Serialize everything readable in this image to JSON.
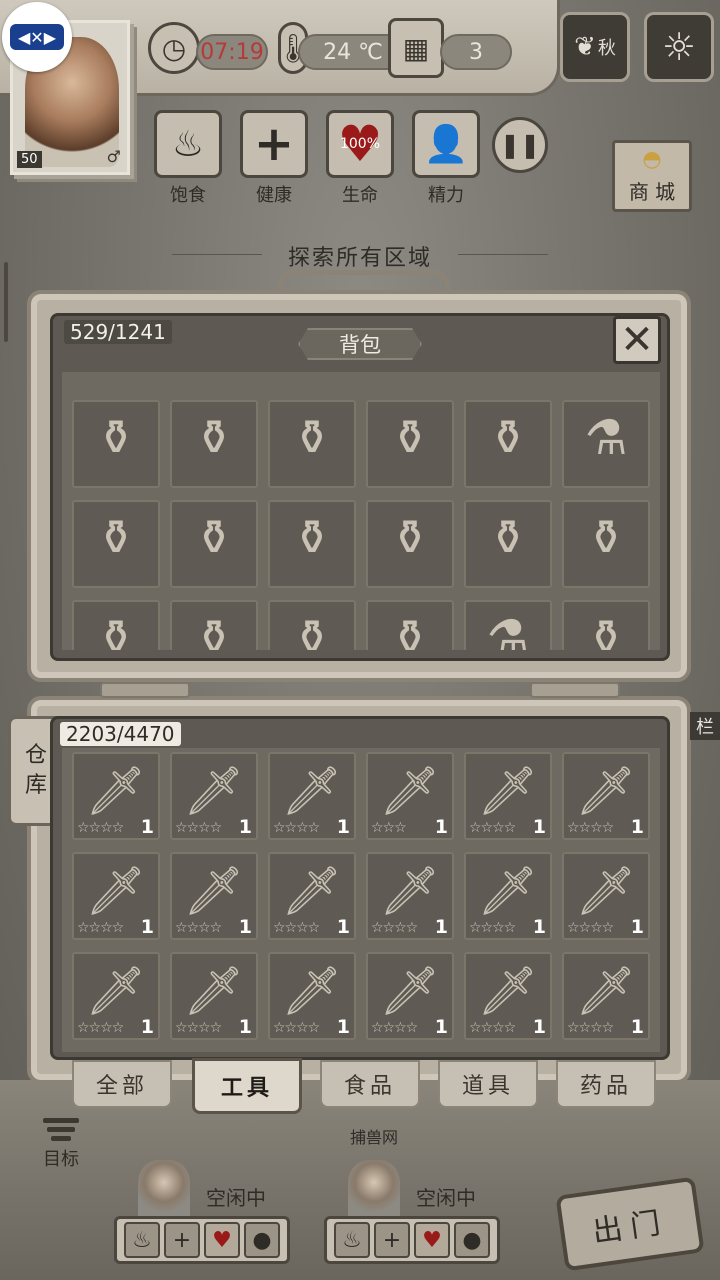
{
  "hud": {
    "level": "50",
    "time": "07:19",
    "temperature": "24 ℃",
    "day": "3",
    "season": "秋",
    "explore_text": "探索所有区域",
    "shop_label": "商 城"
  },
  "needs": [
    {
      "name": "satiety",
      "label": "饱食",
      "value": ""
    },
    {
      "name": "health",
      "label": "健康",
      "value": ""
    },
    {
      "name": "life",
      "label": "生命",
      "value": "100%"
    },
    {
      "name": "energy",
      "label": "精力",
      "value": ""
    }
  ],
  "backpack": {
    "title": "背包",
    "capacity": "529/1241",
    "items": [
      "flask",
      "flask",
      "flask",
      "flask",
      "flask",
      "round-flask",
      "flask",
      "flask",
      "flask",
      "flask",
      "flask",
      "flask",
      "flask",
      "flask",
      "flask",
      "flask",
      "round-flask",
      "flask"
    ]
  },
  "warehouse": {
    "tab_label_1": "仓",
    "tab_label_2": "库",
    "capacity": "2203/4470",
    "items": [
      {
        "qty": "1",
        "stars": "☆☆☆☆"
      },
      {
        "qty": "1",
        "stars": "☆☆☆☆"
      },
      {
        "qty": "1",
        "stars": "☆☆☆☆"
      },
      {
        "qty": "1",
        "stars": "☆☆☆"
      },
      {
        "qty": "1",
        "stars": "☆☆☆☆"
      },
      {
        "qty": "1",
        "stars": "☆☆☆☆"
      },
      {
        "qty": "1",
        "stars": "☆☆☆☆"
      },
      {
        "qty": "1",
        "stars": "☆☆☆☆"
      },
      {
        "qty": "1",
        "stars": "☆☆☆☆"
      },
      {
        "qty": "1",
        "stars": "☆☆☆☆"
      },
      {
        "qty": "1",
        "stars": "☆☆☆☆"
      },
      {
        "qty": "1",
        "stars": "☆☆☆☆"
      },
      {
        "qty": "1",
        "stars": "☆☆☆☆"
      },
      {
        "qty": "1",
        "stars": "☆☆☆☆"
      },
      {
        "qty": "1",
        "stars": "☆☆☆☆"
      },
      {
        "qty": "1",
        "stars": "☆☆☆☆"
      },
      {
        "qty": "1",
        "stars": "☆☆☆☆"
      },
      {
        "qty": "1",
        "stars": "☆☆☆☆"
      }
    ]
  },
  "categories": [
    {
      "label": "全部",
      "active": false
    },
    {
      "label": "工具",
      "active": true
    },
    {
      "label": "食品",
      "active": false
    },
    {
      "label": "道具",
      "active": false
    },
    {
      "label": "药品",
      "active": false
    }
  ],
  "scene": {
    "trap_label": "捕兽网",
    "goal_label": "目标",
    "exit_label": "出门",
    "side_label": "栏"
  },
  "companions": [
    {
      "status": "空闲中"
    },
    {
      "status": "空闲中"
    }
  ],
  "colors": {
    "life_heart": "#9a1a1a",
    "time_text": "#b53a3a"
  }
}
